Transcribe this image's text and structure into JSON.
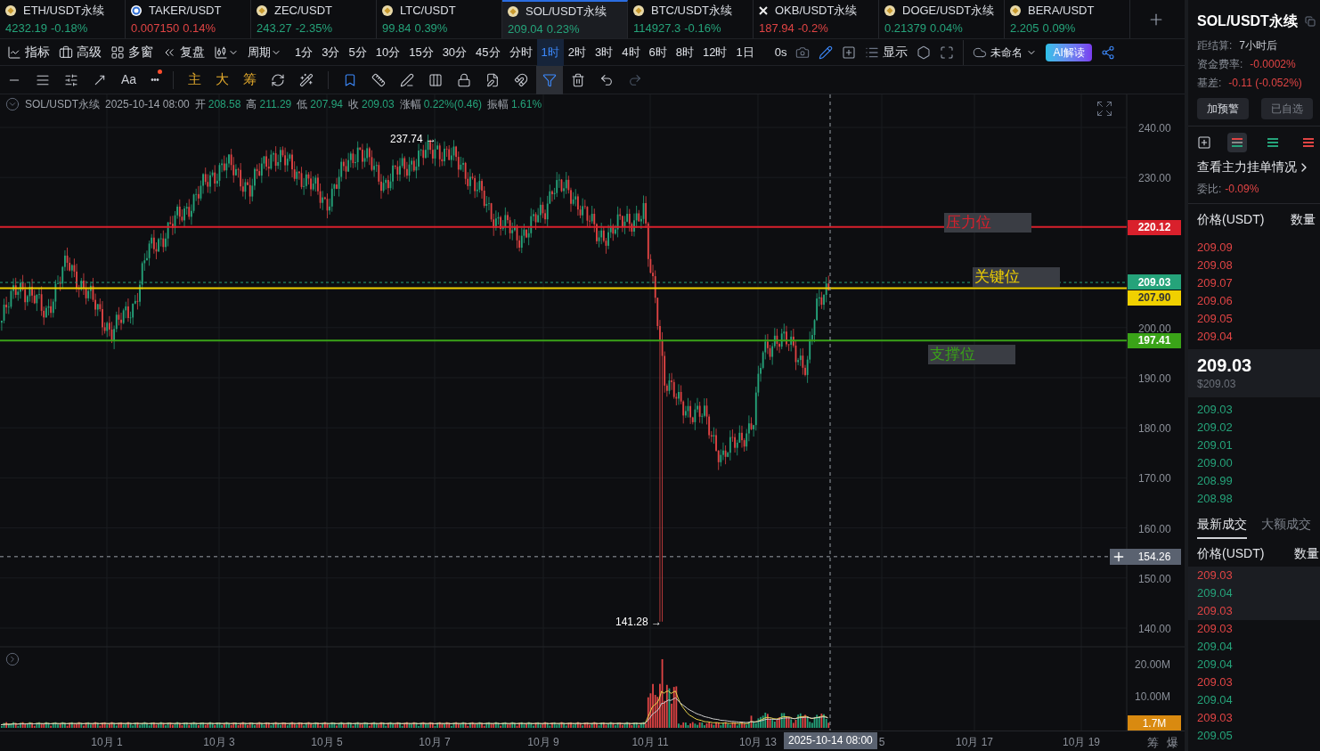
{
  "tickers": [
    {
      "symbol": "ETH/USDT永续",
      "price": "4232.19",
      "change": "-0.18%",
      "color": "#25a37a",
      "selected": false
    },
    {
      "symbol": "TAKER/USDT",
      "price": "0.007150",
      "change": "0.14%",
      "color": "#e04444",
      "selected": false
    },
    {
      "symbol": "ZEC/USDT",
      "price": "243.27",
      "change": "-2.35%",
      "color": "#25a37a",
      "selected": false
    },
    {
      "symbol": "LTC/USDT",
      "price": "99.84",
      "change": "0.39%",
      "color": "#25a37a",
      "selected": false
    },
    {
      "symbol": "SOL/USDT永续",
      "price": "209.04",
      "change": "0.23%",
      "color": "#25a37a",
      "selected": true
    },
    {
      "symbol": "BTC/USDT永续",
      "price": "114927.3",
      "change": "-0.16%",
      "color": "#25a37a",
      "selected": false
    },
    {
      "symbol": "OKB/USDT永续",
      "price": "187.94",
      "change": "-0.2%",
      "color": "#e04444",
      "selected": false
    },
    {
      "symbol": "DOGE/USDT永续",
      "price": "0.21379",
      "change": "0.04%",
      "color": "#25a37a",
      "selected": false
    },
    {
      "symbol": "BERA/USDT",
      "price": "2.205",
      "change": "0.09%",
      "color": "#25a37a",
      "selected": false
    }
  ],
  "toolbar": {
    "menus": [
      "指标",
      "高级",
      "多窗",
      "复盘"
    ],
    "period": "周期",
    "timeframes": [
      {
        "label": "1分",
        "selected": false
      },
      {
        "label": "3分",
        "selected": false
      },
      {
        "label": "5分",
        "selected": false
      },
      {
        "label": "10分",
        "selected": false
      },
      {
        "label": "15分",
        "selected": false
      },
      {
        "label": "30分",
        "selected": false
      },
      {
        "label": "45分",
        "selected": false
      },
      {
        "label": "分时",
        "selected": false
      },
      {
        "label": "1时",
        "selected": true
      },
      {
        "label": "2时",
        "selected": false
      },
      {
        "label": "3时",
        "selected": false
      },
      {
        "label": "4时",
        "selected": false
      },
      {
        "label": "6时",
        "selected": false
      },
      {
        "label": "8时",
        "selected": false
      },
      {
        "label": "12时",
        "selected": false
      },
      {
        "label": "1日",
        "selected": false
      }
    ],
    "countdown": "0s",
    "display": "显示",
    "layout_name": "未命名",
    "ai_button": "AI解读"
  },
  "drawing_tools": {
    "text_tool": "Aa",
    "more": "•••",
    "indicators": [
      "主",
      "大",
      "筹"
    ]
  },
  "ohlc_info": {
    "symbol": "SOL/USDT永续",
    "time": "2025-10-14 08:00",
    "fields": [
      {
        "label": "开",
        "value": "208.58"
      },
      {
        "label": "高",
        "value": "211.29"
      },
      {
        "label": "低",
        "value": "207.94"
      },
      {
        "label": "收",
        "value": "209.03"
      },
      {
        "label": "涨幅",
        "value": "0.22%(0.46)"
      },
      {
        "label": "振幅",
        "value": "1.61%"
      }
    ]
  },
  "chart": {
    "y_ticks": [
      "240.00",
      "230.00",
      "200.00",
      "190.00",
      "180.00",
      "170.00",
      "160.00",
      "150.00",
      "140.00"
    ],
    "volume_ticks": [
      "20.00M",
      "10.00M"
    ],
    "x_ticks": [
      "10月 1",
      "10月 3",
      "10月 5",
      "10月 7",
      "10月 9",
      "10月 11",
      "10月 13",
      "5",
      "10月 17",
      "10月 19"
    ],
    "crosshair_time": "2025-10-14 08:00",
    "levels": [
      {
        "price": "220.12",
        "color": "#d9202c",
        "tag": "压力位"
      },
      {
        "price": "207.90",
        "color": "#f0d000",
        "tag": "关键位"
      },
      {
        "price": "197.41",
        "color": "#3aa318",
        "tag": "支撑位"
      }
    ],
    "last_price": "209.03",
    "cursor_price": "154.26",
    "volume_label": "1.7M",
    "high_marker": "237.74 →",
    "low_marker": "141.28 →",
    "axis_tools": [
      "筹",
      "爆"
    ]
  },
  "side": {
    "title": "SOL/USDT永续",
    "stats": [
      {
        "label": "距结算:",
        "value": "7小时后",
        "color": "#c9ccd3"
      },
      {
        "label": "资金费率:",
        "value": "-0.0002%",
        "color": "#e04444"
      },
      {
        "label": "基差:",
        "value": "-0.11 (-0.052%)",
        "color": "#e04444"
      }
    ],
    "buttons": [
      "加预警",
      "已自选"
    ],
    "view_modes": [
      {
        "kind": "both",
        "selected": true
      },
      {
        "kind": "bids",
        "selected": false
      },
      {
        "kind": "asks",
        "selected": false
      }
    ],
    "depth_link": "查看主力挂单情况",
    "ratio": {
      "label": "委比:",
      "value": "-0.09%"
    },
    "book_header": [
      "价格(USDT)",
      "数量"
    ],
    "asks": [
      "209.09",
      "209.08",
      "209.07",
      "209.06",
      "209.05",
      "209.04"
    ],
    "mid": {
      "price": "209.03",
      "usd": "$209.03"
    },
    "bids": [
      "209.03",
      "209.02",
      "209.01",
      "209.00",
      "208.99",
      "208.98"
    ],
    "trade_tabs": [
      {
        "label": "最新成交",
        "selected": true
      },
      {
        "label": "大额成交",
        "selected": false
      }
    ],
    "trade_header": [
      "价格(USDT)",
      "数量"
    ],
    "trades": [
      {
        "price": "209.03",
        "color": "#e04444"
      },
      {
        "price": "209.04",
        "color": "#25a37a"
      },
      {
        "price": "209.03",
        "color": "#e04444"
      },
      {
        "price": "209.03",
        "color": "#e04444"
      },
      {
        "price": "209.04",
        "color": "#25a37a"
      },
      {
        "price": "209.04",
        "color": "#25a37a"
      },
      {
        "price": "209.03",
        "color": "#e04444"
      },
      {
        "price": "209.04",
        "color": "#25a37a"
      },
      {
        "price": "209.03",
        "color": "#e04444"
      },
      {
        "price": "209.05",
        "color": "#25a37a"
      }
    ]
  }
}
